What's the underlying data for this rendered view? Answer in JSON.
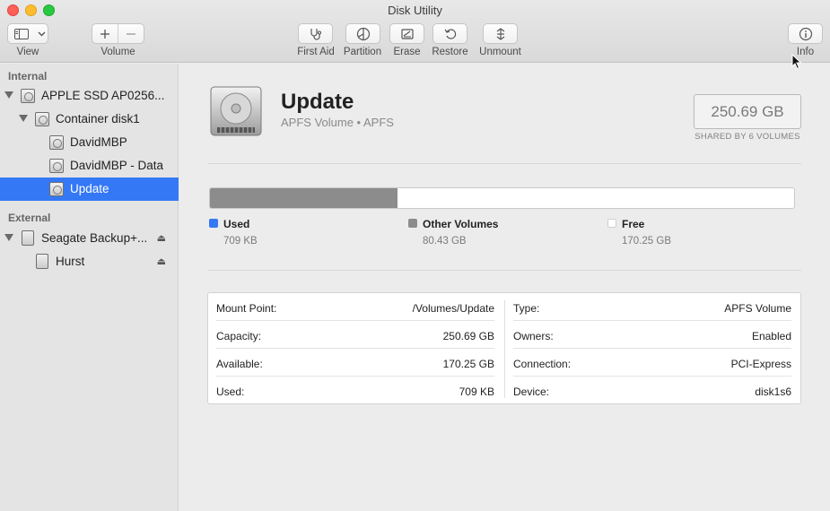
{
  "window": {
    "title": "Disk Utility"
  },
  "toolbar": {
    "view_label": "View",
    "volume_label": "Volume",
    "first_aid_label": "First Aid",
    "partition_label": "Partition",
    "erase_label": "Erase",
    "restore_label": "Restore",
    "unmount_label": "Unmount",
    "info_label": "Info"
  },
  "sidebar": {
    "internal_title": "Internal",
    "external_title": "External",
    "internal_items": [
      {
        "label": "APPLE SSD AP0256...",
        "icon": "internal-disk-icon"
      },
      {
        "label": "Container disk1",
        "icon": "container-icon"
      },
      {
        "label": "DavidMBP",
        "icon": "volume-icon"
      },
      {
        "label": "DavidMBP - Data",
        "icon": "volume-icon"
      },
      {
        "label": "Update",
        "icon": "volume-icon",
        "selected": true
      }
    ],
    "external_items": [
      {
        "label": "Seagate Backup+...",
        "icon": "external-disk-icon"
      },
      {
        "label": "Hurst",
        "icon": "external-volume-icon"
      }
    ]
  },
  "volume": {
    "name": "Update",
    "subtitle": "APFS Volume • APFS",
    "size": "250.69 GB",
    "shared_note": "SHARED BY 6 VOLUMES"
  },
  "usage": {
    "used_fraction": 2.8e-06,
    "other_fraction": 0.3209,
    "colors": {
      "used": "#3478f6",
      "other": "#8c8c8c",
      "free": "#ffffff"
    },
    "legend": [
      {
        "label": "Used",
        "value": "709 KB"
      },
      {
        "label": "Other Volumes",
        "value": "80.43 GB"
      },
      {
        "label": "Free",
        "value": "170.25 GB"
      }
    ]
  },
  "details": {
    "left": [
      {
        "key": "Mount Point:",
        "value": "/Volumes/Update"
      },
      {
        "key": "Capacity:",
        "value": "250.69 GB"
      },
      {
        "key": "Available:",
        "value": "170.25 GB"
      },
      {
        "key": "Used:",
        "value": "709 KB"
      }
    ],
    "right": [
      {
        "key": "Type:",
        "value": "APFS Volume"
      },
      {
        "key": "Owners:",
        "value": "Enabled"
      },
      {
        "key": "Connection:",
        "value": "PCI-Express"
      },
      {
        "key": "Device:",
        "value": "disk1s6"
      }
    ]
  }
}
